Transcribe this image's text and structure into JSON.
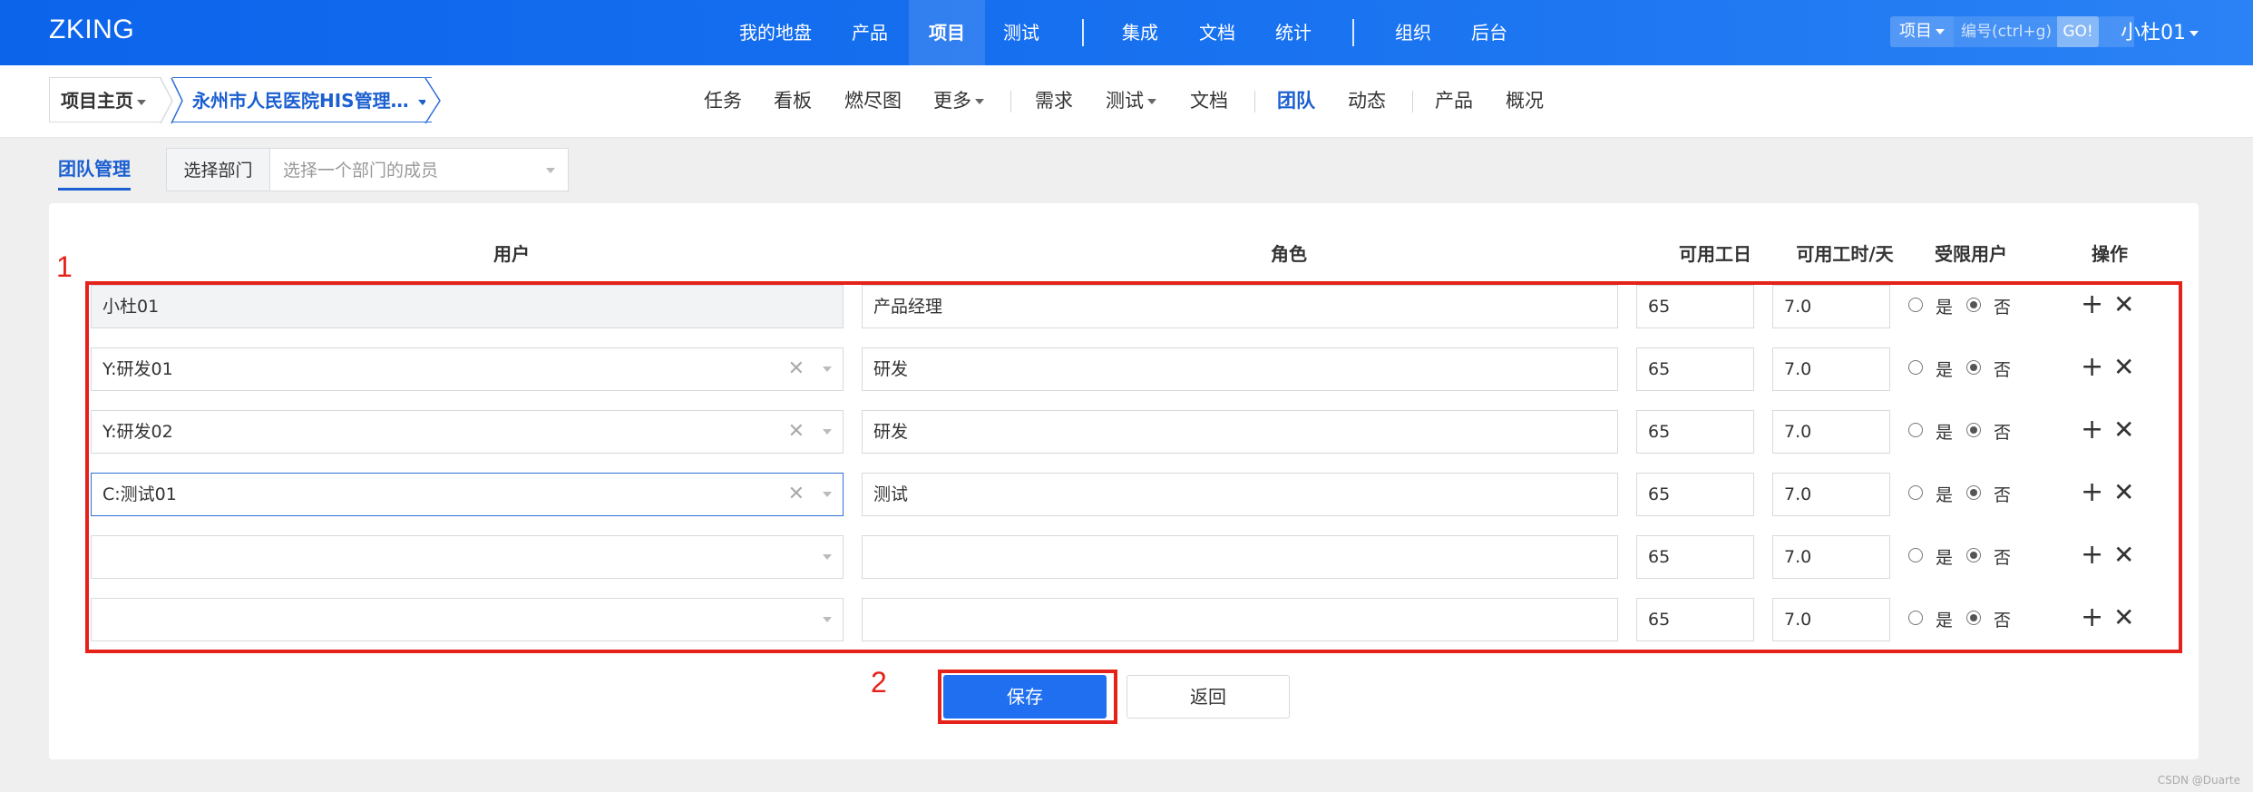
{
  "topnav": {
    "brand": "ZKING",
    "items": [
      "我的地盘",
      "产品",
      "项目",
      "测试",
      "集成",
      "文档",
      "统计",
      "组织",
      "后台"
    ],
    "active": "项目",
    "search_type": "项目",
    "search_placeholder": "编号(ctrl+g)",
    "go_label": "GO!",
    "user": "小杜01"
  },
  "subnav": {
    "home_label": "项目主页",
    "project_label": "永州市人民医院HIS管理…",
    "items": [
      "任务",
      "看板",
      "燃尽图",
      "更多",
      "需求",
      "测试",
      "文档",
      "团队",
      "动态",
      "产品",
      "概况"
    ],
    "active": "团队"
  },
  "team": {
    "tab_label": "团队管理",
    "dept_label": "选择部门",
    "dept_placeholder": "选择一个部门的成员"
  },
  "table": {
    "headers": {
      "user": "用户",
      "role": "角色",
      "days": "可用工日",
      "hours": "可用工时/天",
      "limited": "受限用户",
      "ops": "操作"
    },
    "radio_yes": "是",
    "radio_no": "否",
    "rows": [
      {
        "user": "小杜01",
        "role": "产品经理",
        "days": "65",
        "hours": "7.0",
        "limited": "否",
        "readonly": true
      },
      {
        "user": "Y:研发01",
        "role": "研发",
        "days": "65",
        "hours": "7.0",
        "limited": "否"
      },
      {
        "user": "Y:研发02",
        "role": "研发",
        "days": "65",
        "hours": "7.0",
        "limited": "否"
      },
      {
        "user": "C:测试01",
        "role": "测试",
        "days": "65",
        "hours": "7.0",
        "limited": "否",
        "focused": true
      },
      {
        "user": "",
        "role": "",
        "days": "65",
        "hours": "7.0",
        "limited": "否"
      },
      {
        "user": "",
        "role": "",
        "days": "65",
        "hours": "7.0",
        "limited": "否"
      }
    ]
  },
  "annotations": {
    "box1": "1",
    "box2": "2"
  },
  "buttons": {
    "save": "保存",
    "back": "返回"
  },
  "watermark": "CSDN @Duarte",
  "colors": {
    "primary": "#1f6ff0",
    "annotation": "#e5221a",
    "topbar": "#0c64eb"
  }
}
